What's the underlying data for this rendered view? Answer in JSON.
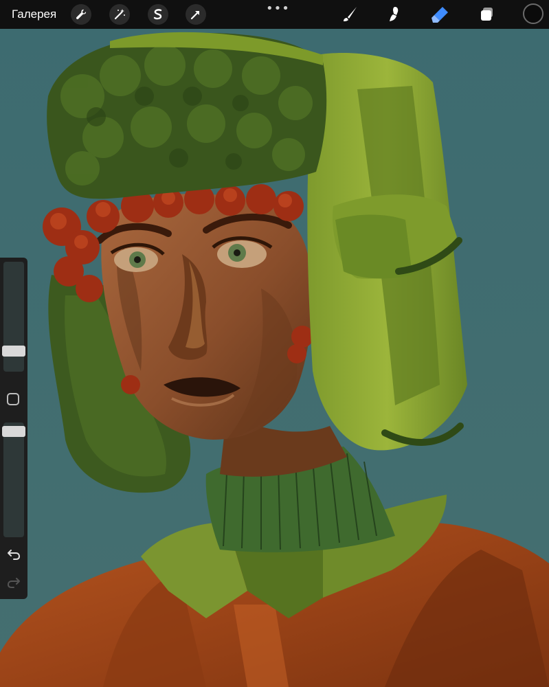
{
  "toolbar": {
    "gallery_label": "Галерея",
    "more_label": "•••",
    "left_tools": [
      "wrench-icon",
      "magic-wand-icon",
      "selection-icon",
      "transform-arrow-icon"
    ],
    "right_tools": [
      "brush-icon",
      "smudge-icon",
      "eraser-icon",
      "layers-icon"
    ],
    "active_tool": "eraser-icon",
    "accent_color": "#3f8cff",
    "current_color": "#0b0b0b"
  },
  "sidebar": {
    "brush_size": 0.2,
    "brush_opacity": 0.96
  },
  "canvas": {
    "background": "#3f6a6e",
    "artwork": "portrait"
  }
}
